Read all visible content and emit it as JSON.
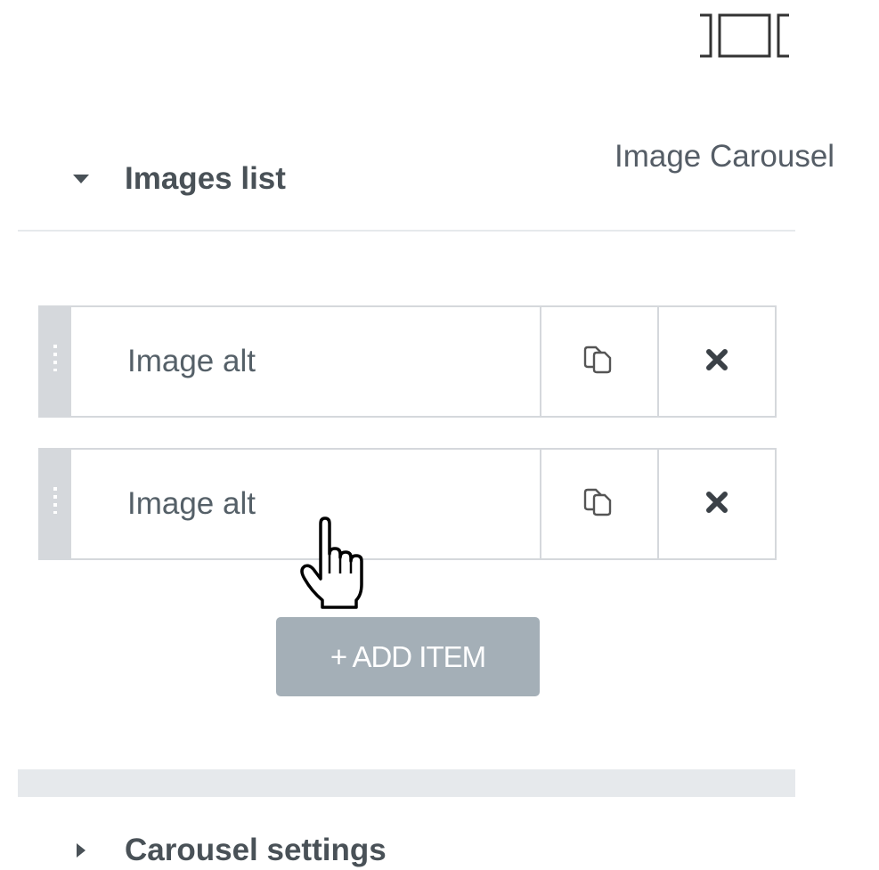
{
  "widget": {
    "title": "Image Carousel",
    "icon": "image-carousel-icon"
  },
  "sections": {
    "images_list": {
      "title": "Images list",
      "expanded": true
    },
    "carousel_settings": {
      "title": "Carousel settings",
      "expanded": false
    }
  },
  "repeater": {
    "items": [
      {
        "label": "Image alt"
      },
      {
        "label": "Image alt"
      }
    ],
    "duplicate_icon": "duplicate-icon",
    "remove_icon": "close-icon",
    "add_label": "+ ADD ITEM"
  },
  "cursor": "hand-pointer-cursor",
  "colors": {
    "text": "#495157",
    "border": "#d5d8dc",
    "button_bg": "#a4afb7",
    "separator": "#e6e9ec"
  }
}
